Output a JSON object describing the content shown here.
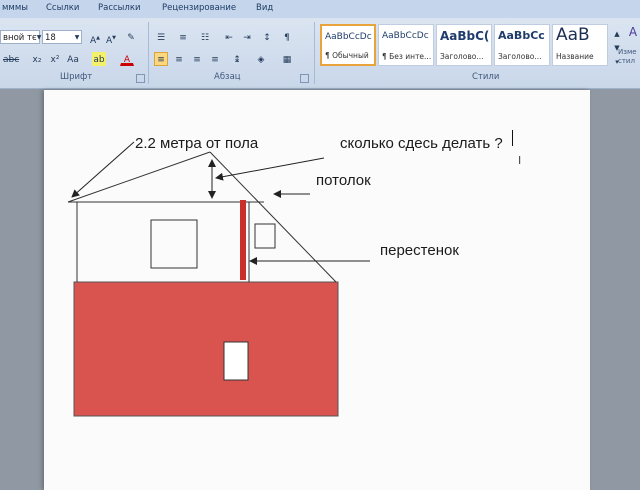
{
  "ribbon": {
    "tabs": [
      "мммы",
      "Ссылки",
      "Рассылки",
      "Рецензирование",
      "Вид"
    ],
    "font": {
      "name": "вной тє",
      "size": "18",
      "group_label": "Шрифт"
    },
    "paragraph": {
      "group_label": "Абзац"
    },
    "styles": {
      "group_label": "Стили",
      "items": [
        {
          "preview": "AaBbCcDc",
          "name": "¶ Обычный",
          "selected": true
        },
        {
          "preview": "AaBbCcDc",
          "name": "¶ Без инте...",
          "selected": false
        },
        {
          "preview": "AaBbC(",
          "name": "Заголово...",
          "selected": false
        },
        {
          "preview": "AaBbCc",
          "name": "Заголово...",
          "selected": false
        },
        {
          "preview": "AaB",
          "name": "Название",
          "selected": false
        }
      ],
      "change_label": "Изме стил"
    },
    "accent_color": "#fbd780"
  },
  "document": {
    "annotations": {
      "height_note": "2.2 метра  от пола",
      "question": "сколько сдесь делать ?",
      "ceiling": "потолок",
      "partition": "перестенок"
    },
    "colors": {
      "fill_red": "#d9534f",
      "partition_red": "#c9302c",
      "outline": "#333333"
    }
  }
}
